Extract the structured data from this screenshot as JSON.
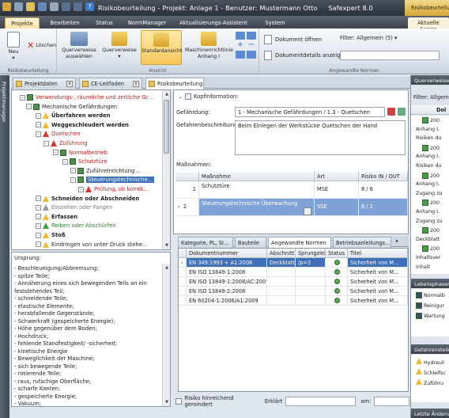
{
  "window": {
    "title": "Risikobeurteilung - Projekt: Anlage 1 - Benutzer: Mustermann Otto",
    "app_name": "Safexpert 8.0",
    "context_tab": "Risikobeurteilu..."
  },
  "menu_tabs": [
    "Projekte",
    "Bearbeiten",
    "Status",
    "NormManager",
    "Aktualisierungs-Assistent",
    "System"
  ],
  "context_subtab": "Aktuelle Auswa",
  "ribbon": {
    "group1": {
      "new": "Neu",
      "delete": "Löschen",
      "caption": "Risikobeurteilung"
    },
    "group2": {
      "btn1": "Querverweise auswählen",
      "btn2": "Querverweise",
      "btn3": "Standardansicht",
      "btn4": "Maschinenrichtlinie Anhang I",
      "caption": "Ansicht"
    },
    "group3": {
      "open_doc": "Dokument öffnen",
      "doc_details": "Dokumentdetails anzeigen",
      "filter_label": "Filter: Allgemein (5)",
      "caption": "Angewandte Normen"
    }
  },
  "left_sidebar": {
    "label": "Projektmanager"
  },
  "doc_tabs": [
    "Projektdaten",
    "CE-Leitfaden",
    "Risikobeurteilung"
  ],
  "tree": [
    {
      "text": "Verwendungs-, räumliche und zeitliche Gr...",
      "style": "red",
      "icon": "sq",
      "indent": 10
    },
    {
      "text": "Mechanische Gefährdungen",
      "style": "",
      "icon": "sq",
      "indent": 18
    },
    {
      "text": "Überfahren werden",
      "style": "bold",
      "icon": "warn",
      "indent": 30
    },
    {
      "text": "Weggeschleudert werden",
      "style": "bold",
      "icon": "warn",
      "indent": 30
    },
    {
      "text": "Quetschen",
      "style": "red",
      "icon": "red",
      "indent": 30
    },
    {
      "text": "Zuführung",
      "style": "red",
      "icon": "red",
      "indent": 40
    },
    {
      "text": "Normalbetrieb",
      "style": "red",
      "icon": "sq",
      "indent": 52
    },
    {
      "text": "Schutztüre",
      "style": "red",
      "icon": "sq",
      "indent": 64
    },
    {
      "text": "Zuführeinrichtung ...",
      "style": "",
      "icon": "sq",
      "indent": 74
    },
    {
      "text": "Steuerungstechnische...",
      "style": "sel",
      "icon": "sq",
      "indent": 74
    },
    {
      "text": "Prüfung, ob korrek...",
      "style": "red",
      "icon": "red",
      "indent": 84
    },
    {
      "text": "Schneiden oder Abschneiden",
      "style": "bold",
      "icon": "warn",
      "indent": 30
    },
    {
      "text": "Einziehen oder Fangen",
      "style": "grey",
      "icon": "grey",
      "indent": 30
    },
    {
      "text": "Erfassen",
      "style": "bold",
      "icon": "warn",
      "indent": 30
    },
    {
      "text": "Reiben oder Abschürfen",
      "style": "green",
      "icon": "green",
      "indent": 30
    },
    {
      "text": "Stoß",
      "style": "bold",
      "icon": "warn",
      "indent": 30
    },
    {
      "text": "Eindringen von unter Druck stehe...",
      "style": "",
      "icon": "warn",
      "indent": 30
    }
  ],
  "origin": {
    "label": "Ursprung:",
    "lines": [
      "- Beschleunigung/Abbremsung;",
      "- spitze Teile;",
      "- Annäherung eines sich bewegenden Teils an ein",
      "feststehendes Teil;",
      "- schneidende Teile;",
      "- elastische Elemente;",
      "- herabfallende Gegenstände;",
      "- Schwerkraft (gespeicherte Energie);",
      "- Höhe gegenüber dem Boden;",
      "- Hochdruck;",
      "- fehlende Standfestigkeit/ -sicherheit;",
      "- kinetische Energie",
      "- Beweglichkeit der Maschine;",
      "- sich bewegende Teile;",
      "- rotierende Teile;",
      "- raus, rutschige Oberfläche;",
      "- scharfe Kanten;",
      "- gespeicherte Energie;",
      "- Vakuum;"
    ]
  },
  "details": {
    "header": "Kopfinformation:",
    "hazard_label": "Gefährdung:",
    "hazard_value": "1 - Mechanische Gefährdungen / 1.3 - Quetschen",
    "desc_label": "Gefahrenbeschreibung:",
    "desc_value": "Beim Einlegen der Werkstücke Quetschen der Hand",
    "measures_label": "Maßnahmen:",
    "measures_cols": [
      "Maßnahme",
      "Art",
      "Risiko IN / OUT"
    ],
    "measures_rows": [
      {
        "num": "1",
        "name": "Schutztüre",
        "art": "MSE",
        "risk": "8 / 6"
      },
      {
        "num": "2",
        "name": "Steuerungstechnische Überwachung",
        "art": "SSE",
        "risk": "6 / 2"
      }
    ]
  },
  "norm_tabs": [
    "Kategorie, PL, SI...",
    "Bauteile",
    "Angewandte Normen",
    "Betriebsanleitungs..."
  ],
  "norms": {
    "cols": [
      "Dokumentnummer",
      "Abschnitt",
      "Sprungziel",
      "Status",
      "Titel"
    ],
    "rows": [
      {
        "doc": "EN 349:1993 + A1:2008",
        "section": "Deckblatt",
        "jump": "/p=3",
        "title": "Sicherheit von M..."
      },
      {
        "doc": "EN ISO 13849-1:2008",
        "section": "",
        "jump": "",
        "title": "Sicherheit von M..."
      },
      {
        "doc": "EN ISO 13849-1:2008/AC:2009",
        "section": "",
        "jump": "",
        "title": "Sicherheit von M..."
      },
      {
        "doc": "EN ISO 13849-2:2008",
        "section": "",
        "jump": "",
        "title": "Sicherheit von M..."
      },
      {
        "doc": "EN 60204-1:2006/A1:2009",
        "section": "",
        "jump": "",
        "title": "Sicherheit von M..."
      }
    ]
  },
  "bottom": {
    "checkbox_label": "Risiko hinreichend gemindert",
    "explained_label": "Erklärt",
    "on_label": "am:"
  },
  "right_panel": {
    "header": "Querverweise",
    "filter": "Filter: Allgemi",
    "col_header": "Dol",
    "items": [
      "200",
      "Anhang I,",
      "Risiken du",
      "200",
      "Anhang I,",
      "Risiken du",
      "200",
      "Anhang I,",
      "Zugang zu",
      "200",
      "Anhang I,",
      "Zugang zu",
      "200",
      "Deckblatt",
      "200",
      "Inhaltsver",
      "Inhalt"
    ],
    "phases_header": "Lebensphasen",
    "phases": [
      "Normalb",
      "Reinigur",
      "Wartung"
    ],
    "hazards_header": "Gefahrenstelle",
    "hazards": [
      "Hydrauli",
      "Schleifsc",
      "Zuführu"
    ],
    "last_changes": "Letzte Änderu"
  }
}
